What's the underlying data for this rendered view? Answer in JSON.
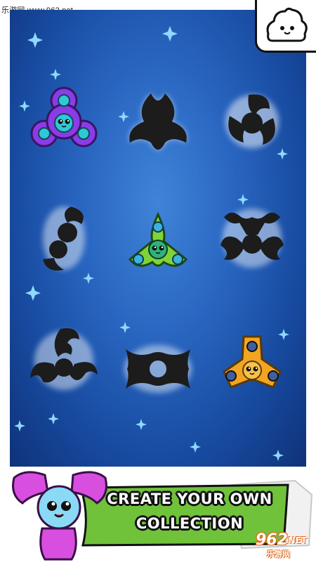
{
  "watermark_top": {
    "text": "乐游网 www.962.net"
  },
  "menu": {
    "icon": "mascot-blob-icon"
  },
  "grid": {
    "slots": [
      {
        "state": "unlocked",
        "color": "#8a3ce6",
        "accent": "#2fc9d6"
      },
      {
        "state": "locked",
        "shape": "tri-blade"
      },
      {
        "state": "locked",
        "shape": "swirl"
      },
      {
        "state": "locked",
        "shape": "curl"
      },
      {
        "state": "unlocked",
        "color": "#7fd33a",
        "accent": "#39b3d9"
      },
      {
        "state": "locked",
        "shape": "ornate"
      },
      {
        "state": "locked",
        "shape": "claw"
      },
      {
        "state": "locked",
        "shape": "ring"
      },
      {
        "state": "unlocked",
        "color": "#f2a423",
        "accent": "#3f5f9f"
      }
    ]
  },
  "banner": {
    "line1": "CREATE YOUR OWN",
    "line2": "COLLECTION",
    "mascot_icon": "pink-spinner-mascot-icon"
  },
  "corner_watermark": {
    "logo": "962",
    "net": ".NET",
    "sub": "乐游网"
  },
  "colors": {
    "panel": "#2a67c2",
    "banner_green": "#6fc23a",
    "silhouette": "#1c1c1c"
  }
}
